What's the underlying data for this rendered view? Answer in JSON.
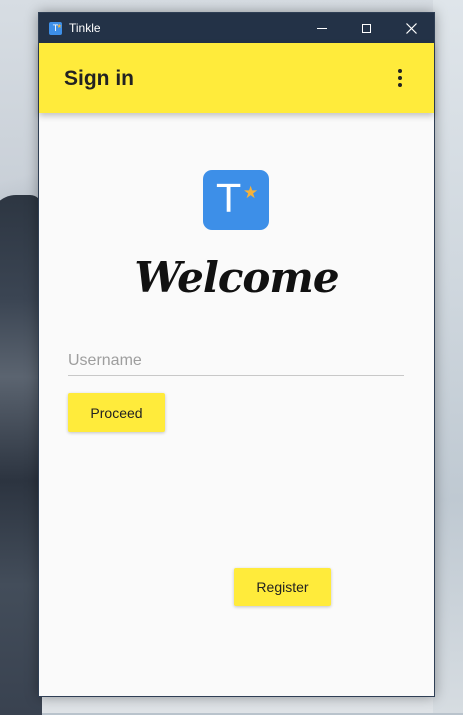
{
  "window": {
    "title": "Tinkle",
    "app_icon_letter": "T"
  },
  "appbar": {
    "title": "Sign in",
    "background": "#ffeb3b"
  },
  "logo": {
    "letter": "T",
    "star": "★",
    "background": "#3d8fe8",
    "star_color": "#f6b23a"
  },
  "welcome_text": "Welcome",
  "username": {
    "placeholder": "Username",
    "value": ""
  },
  "buttons": {
    "proceed": "Proceed",
    "register": "Register"
  },
  "icons": {
    "minimize": "minimize-icon",
    "maximize": "maximize-icon",
    "close": "close-icon",
    "menu": "more-vert-icon"
  }
}
